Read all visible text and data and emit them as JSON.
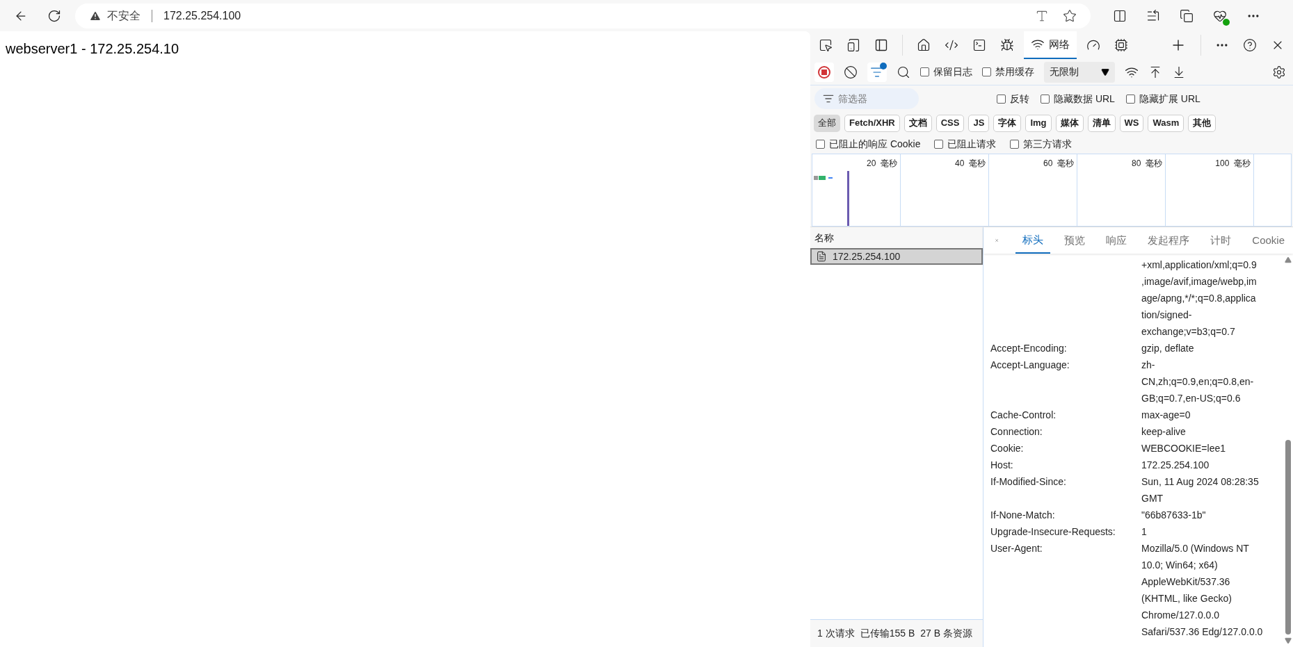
{
  "browser": {
    "security_label": "不安全",
    "url": "172.25.254.100"
  },
  "page": {
    "text": "webserver1 - 172.25.254.10"
  },
  "devtools": {
    "tabs": [
      {
        "selected": false
      },
      {
        "selected": false
      },
      {
        "label": "网络",
        "selected": true
      },
      {
        "selected": false
      },
      {
        "selected": false
      }
    ],
    "toolbar": {
      "recording": true,
      "filter_active": true,
      "checkboxes": [
        {
          "label": "保留日志",
          "checked": false
        },
        {
          "label": "禁用缓存",
          "checked": false
        }
      ],
      "throttling": "无限制"
    },
    "filter": {
      "placeholder": "筛选器",
      "checkboxes": [
        {
          "label": "反转",
          "checked": false
        },
        {
          "label": "隐藏数据 URL",
          "checked": false
        },
        {
          "label": "隐藏扩展 URL",
          "checked": false
        }
      ]
    },
    "types": [
      {
        "label": "全部",
        "selected": true
      },
      {
        "label": "Fetch/XHR",
        "selected": false
      },
      {
        "label": "文档",
        "selected": false
      },
      {
        "label": "CSS",
        "selected": false
      },
      {
        "label": "JS",
        "selected": false
      },
      {
        "label": "字体",
        "selected": false
      },
      {
        "label": "Img",
        "selected": false
      },
      {
        "label": "媒体",
        "selected": false
      },
      {
        "label": "清单",
        "selected": false
      },
      {
        "label": "WS",
        "selected": false
      },
      {
        "label": "Wasm",
        "selected": false
      },
      {
        "label": "其他",
        "selected": false
      }
    ],
    "more_checkboxes": [
      {
        "label": "已阻止的响应 Cookie",
        "checked": false
      },
      {
        "label": "已阻止请求",
        "checked": false
      },
      {
        "label": "第三方请求",
        "checked": false
      }
    ],
    "timeline": {
      "ticks": [
        "20  毫秒",
        "40  毫秒",
        "60  毫秒",
        "80  毫秒",
        "100  毫秒"
      ]
    },
    "requests": {
      "column": "名称",
      "rows": [
        {
          "name": "172.25.254.100",
          "selected": true
        }
      ]
    },
    "status_bar": [
      "1 次请求",
      "已传输155 B",
      "27 B 条资源"
    ],
    "detail_tabs": [
      {
        "label": "标头",
        "selected": true
      },
      {
        "label": "预览",
        "selected": false
      },
      {
        "label": "响应",
        "selected": false
      },
      {
        "label": "发起程序",
        "selected": false
      },
      {
        "label": "计时",
        "selected": false
      },
      {
        "label": "Cookie",
        "selected": false
      }
    ],
    "headers": [
      {
        "value_lines": [
          "+xml,application/xml;q=0.9",
          ",image/avif,image/webp,im",
          "age/apng,*/*;q=0.8,applica",
          "tion/signed-",
          "exchange;v=b3;q=0.7"
        ]
      },
      {
        "name": "Accept-Encoding:",
        "value_lines": [
          "gzip, deflate"
        ]
      },
      {
        "name": "Accept-Language:",
        "value_lines": [
          "zh-",
          "CN,zh;q=0.9,en;q=0.8,en-",
          "GB;q=0.7,en-US;q=0.6"
        ]
      },
      {
        "name": "Cache-Control:",
        "value_lines": [
          "max-age=0"
        ]
      },
      {
        "name": "Connection:",
        "value_lines": [
          "keep-alive"
        ]
      },
      {
        "name": "Cookie:",
        "value_lines": [
          "WEBCOOKIE=lee1"
        ]
      },
      {
        "name": "Host:",
        "value_lines": [
          "172.25.254.100"
        ]
      },
      {
        "name": "If-Modified-Since:",
        "value_lines": [
          "Sun, 11 Aug 2024 08:28:35",
          "GMT"
        ]
      },
      {
        "name": "If-None-Match:",
        "value_lines": [
          "\"66b87633-1b\""
        ]
      },
      {
        "name": "Upgrade-Insecure-Requests:",
        "value_lines": [
          "1"
        ]
      },
      {
        "name": "User-Agent:",
        "value_lines": [
          "Mozilla/5.0 (Windows NT",
          "10.0; Win64; x64)",
          "AppleWebKit/537.36",
          "(KHTML, like Gecko)",
          "Chrome/127.0.0.0",
          "Safari/537.36 Edg/127.0.0.0"
        ]
      }
    ]
  }
}
